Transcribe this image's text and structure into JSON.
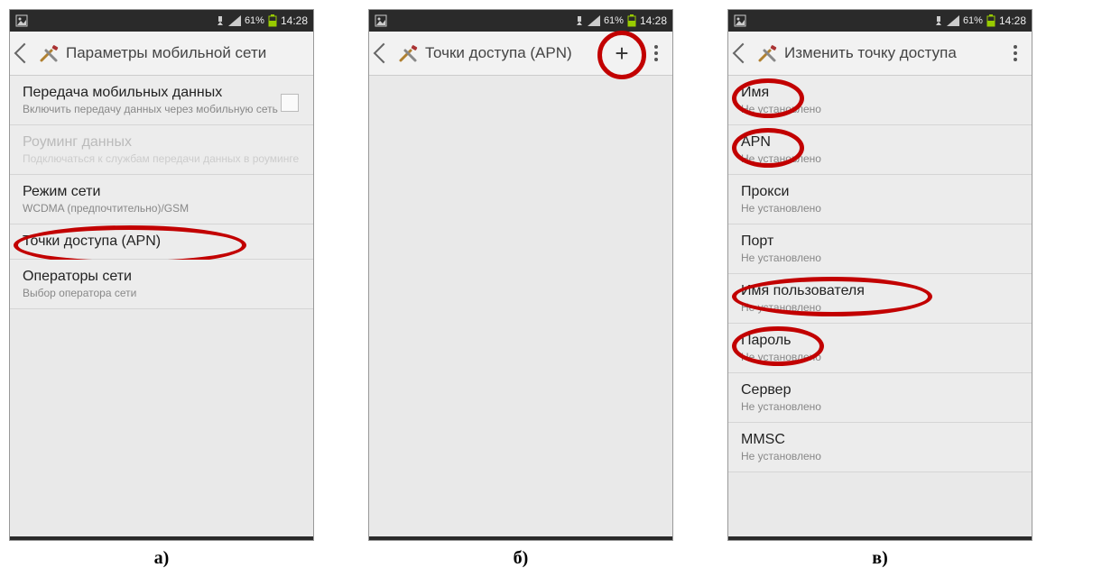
{
  "status": {
    "battery": "61%",
    "time": "14:28"
  },
  "screens": [
    {
      "header_title": "Параметры мобильной сети",
      "caption": "а)",
      "add_button": false,
      "items": [
        {
          "title": "Передача мобильных данных",
          "sub": "Включить передачу данных через мобильную сеть",
          "disabled": false,
          "checkbox": true,
          "circled": false
        },
        {
          "title": "Роуминг данных",
          "sub": "Подключаться к службам передачи данных в роуминге",
          "disabled": true,
          "checkbox": false,
          "circled": false
        },
        {
          "title": "Режим сети",
          "sub": "WCDMA (предпочтительно)/GSM",
          "disabled": false,
          "checkbox": false,
          "circled": false
        },
        {
          "title": "Точки доступа (APN)",
          "sub": "",
          "disabled": false,
          "checkbox": false,
          "circled": true
        },
        {
          "title": "Операторы сети",
          "sub": "Выбор оператора сети",
          "disabled": false,
          "checkbox": false,
          "circled": false
        }
      ]
    },
    {
      "header_title": "Точки доступа (APN)",
      "caption": "б)",
      "add_button": true,
      "items": []
    },
    {
      "header_title": "Изменить точку доступа",
      "caption": "в)",
      "add_button": false,
      "more_only": true,
      "items": [
        {
          "title": "Имя",
          "sub": "Не установлено",
          "circled": true
        },
        {
          "title": "APN",
          "sub": "Не установлено",
          "circled": true
        },
        {
          "title": "Прокси",
          "sub": "Не установлено",
          "circled": false
        },
        {
          "title": "Порт",
          "sub": "Не установлено",
          "circled": false
        },
        {
          "title": "Имя пользователя",
          "sub": "Не установлено",
          "circled": true
        },
        {
          "title": "Пароль",
          "sub": "Не установлено",
          "circled": true
        },
        {
          "title": "Сервер",
          "sub": "Не установлено",
          "circled": false
        },
        {
          "title": "MMSC",
          "sub": "Не установлено",
          "circled": false
        }
      ]
    }
  ]
}
